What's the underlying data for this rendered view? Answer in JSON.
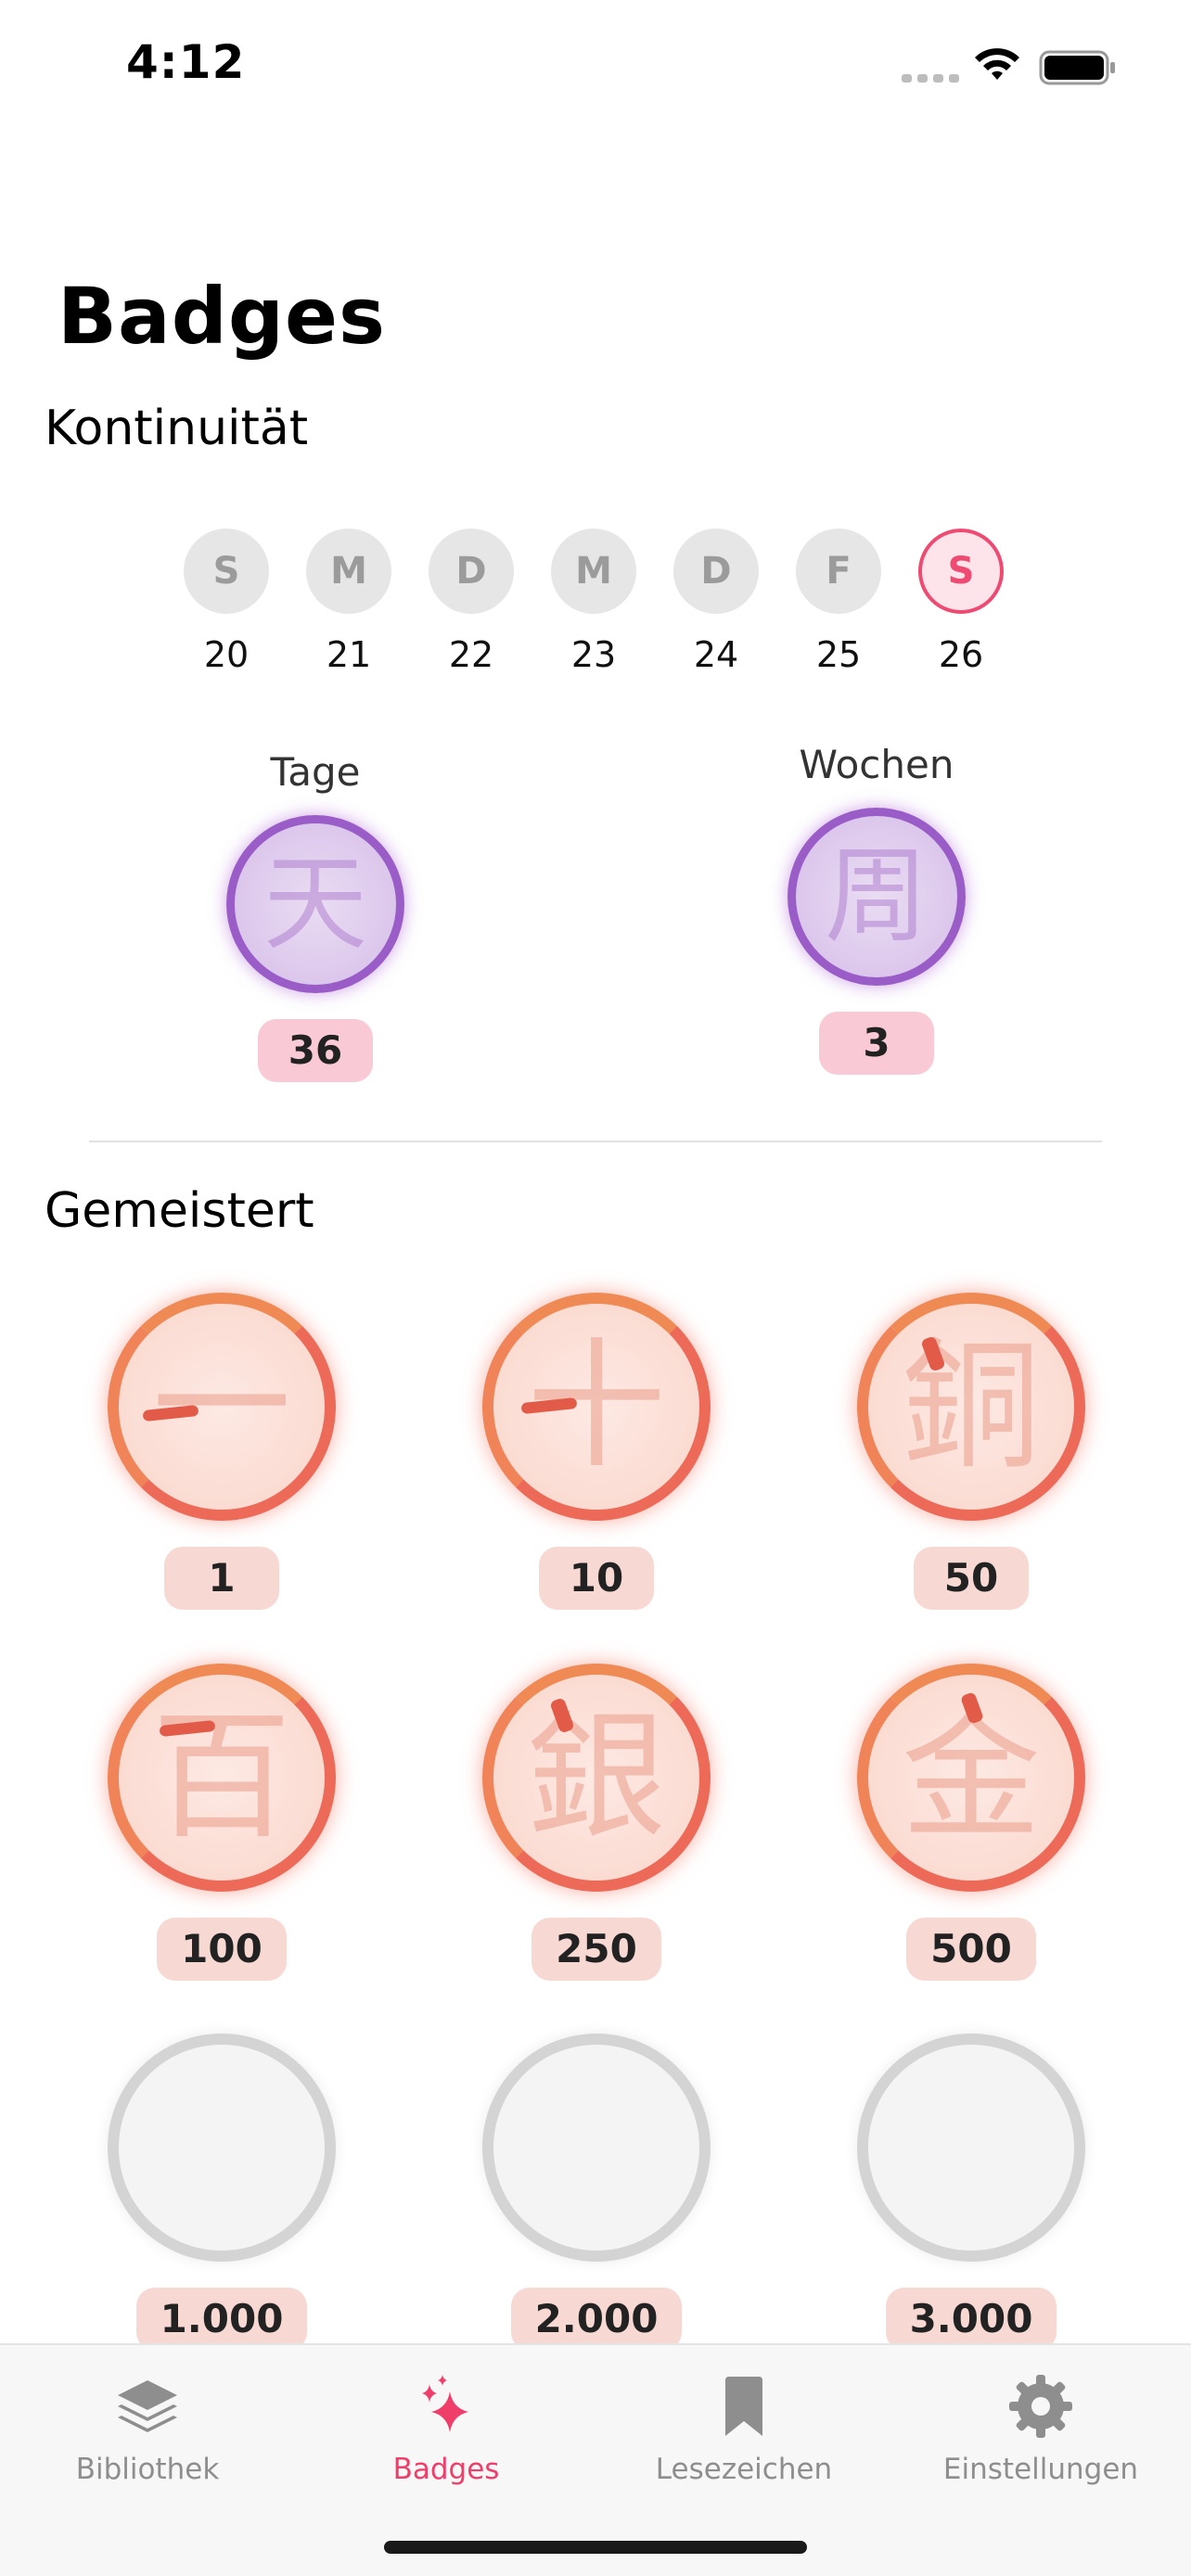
{
  "status_bar": {
    "time": "4:12"
  },
  "page_title": "Badges",
  "continuity": {
    "title": "Kontinuität",
    "days": [
      {
        "letter": "S",
        "num": "20",
        "today": false
      },
      {
        "letter": "M",
        "num": "21",
        "today": false
      },
      {
        "letter": "D",
        "num": "22",
        "today": false
      },
      {
        "letter": "M",
        "num": "23",
        "today": false
      },
      {
        "letter": "D",
        "num": "24",
        "today": false
      },
      {
        "letter": "F",
        "num": "25",
        "today": false
      },
      {
        "letter": "S",
        "num": "26",
        "today": true
      }
    ],
    "days_streak": {
      "label": "Tage",
      "kanji": "天",
      "count": "36"
    },
    "weeks_streak": {
      "label": "Wochen",
      "kanji": "周",
      "count": "3"
    }
  },
  "mastered": {
    "title": "Gemeistert",
    "badges": [
      {
        "kanji": "一",
        "count": "1",
        "earned": true
      },
      {
        "kanji": "十",
        "count": "10",
        "earned": true
      },
      {
        "kanji": "銅",
        "count": "50",
        "earned": true
      },
      {
        "kanji": "百",
        "count": "100",
        "earned": true
      },
      {
        "kanji": "銀",
        "count": "250",
        "earned": true
      },
      {
        "kanji": "金",
        "count": "500",
        "earned": true
      },
      {
        "kanji": "",
        "count": "1.000",
        "earned": false
      },
      {
        "kanji": "",
        "count": "2.000",
        "earned": false
      },
      {
        "kanji": "",
        "count": "3.000",
        "earned": false
      }
    ]
  },
  "tab_bar": {
    "tabs": [
      {
        "label": "Bibliothek",
        "icon": "stack-icon",
        "active": false
      },
      {
        "label": "Badges",
        "icon": "sparkles-icon",
        "active": true
      },
      {
        "label": "Lesezeichen",
        "icon": "bookmark-icon",
        "active": false
      },
      {
        "label": "Einstellungen",
        "icon": "gear-icon",
        "active": false
      }
    ]
  },
  "colors": {
    "accent": "#ef3e6a",
    "purple_ring": "#9a5cc6",
    "orange_ring": "#ee6a58",
    "grey_ring": "#d4d4d4"
  }
}
